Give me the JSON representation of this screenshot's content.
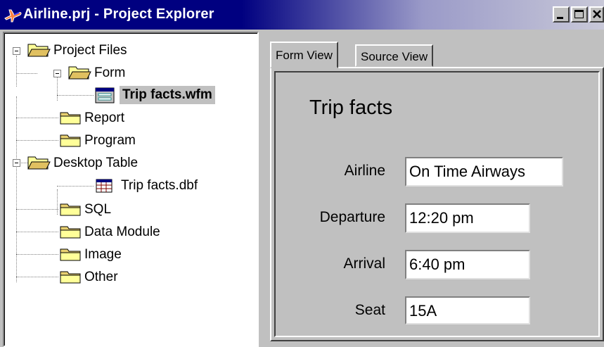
{
  "window": {
    "title": "Airline.prj - Project Explorer"
  },
  "tree": {
    "root": "Project Files",
    "form": "Form",
    "form_file": "Trip facts.wfm",
    "report": "Report",
    "program": "Program",
    "desktop_table": "Desktop Table",
    "table_file": "Trip facts.dbf",
    "sql": "SQL",
    "data_module": "Data Module",
    "image": "Image",
    "other": "Other"
  },
  "tabs": {
    "form_view": "Form View",
    "source_view": "Source View"
  },
  "form": {
    "title": "Trip facts",
    "airline_label": "Airline",
    "airline_value": "On Time Airways",
    "departure_label": "Departure",
    "departure_value": "12:20 pm",
    "arrival_label": "Arrival",
    "arrival_value": "6:40 pm",
    "seat_label": "Seat",
    "seat_value": "15A"
  },
  "icons": {
    "title": "airplane-icon",
    "folder": "folder-icon",
    "form_file": "form-file-icon",
    "table_file": "table-file-icon"
  }
}
